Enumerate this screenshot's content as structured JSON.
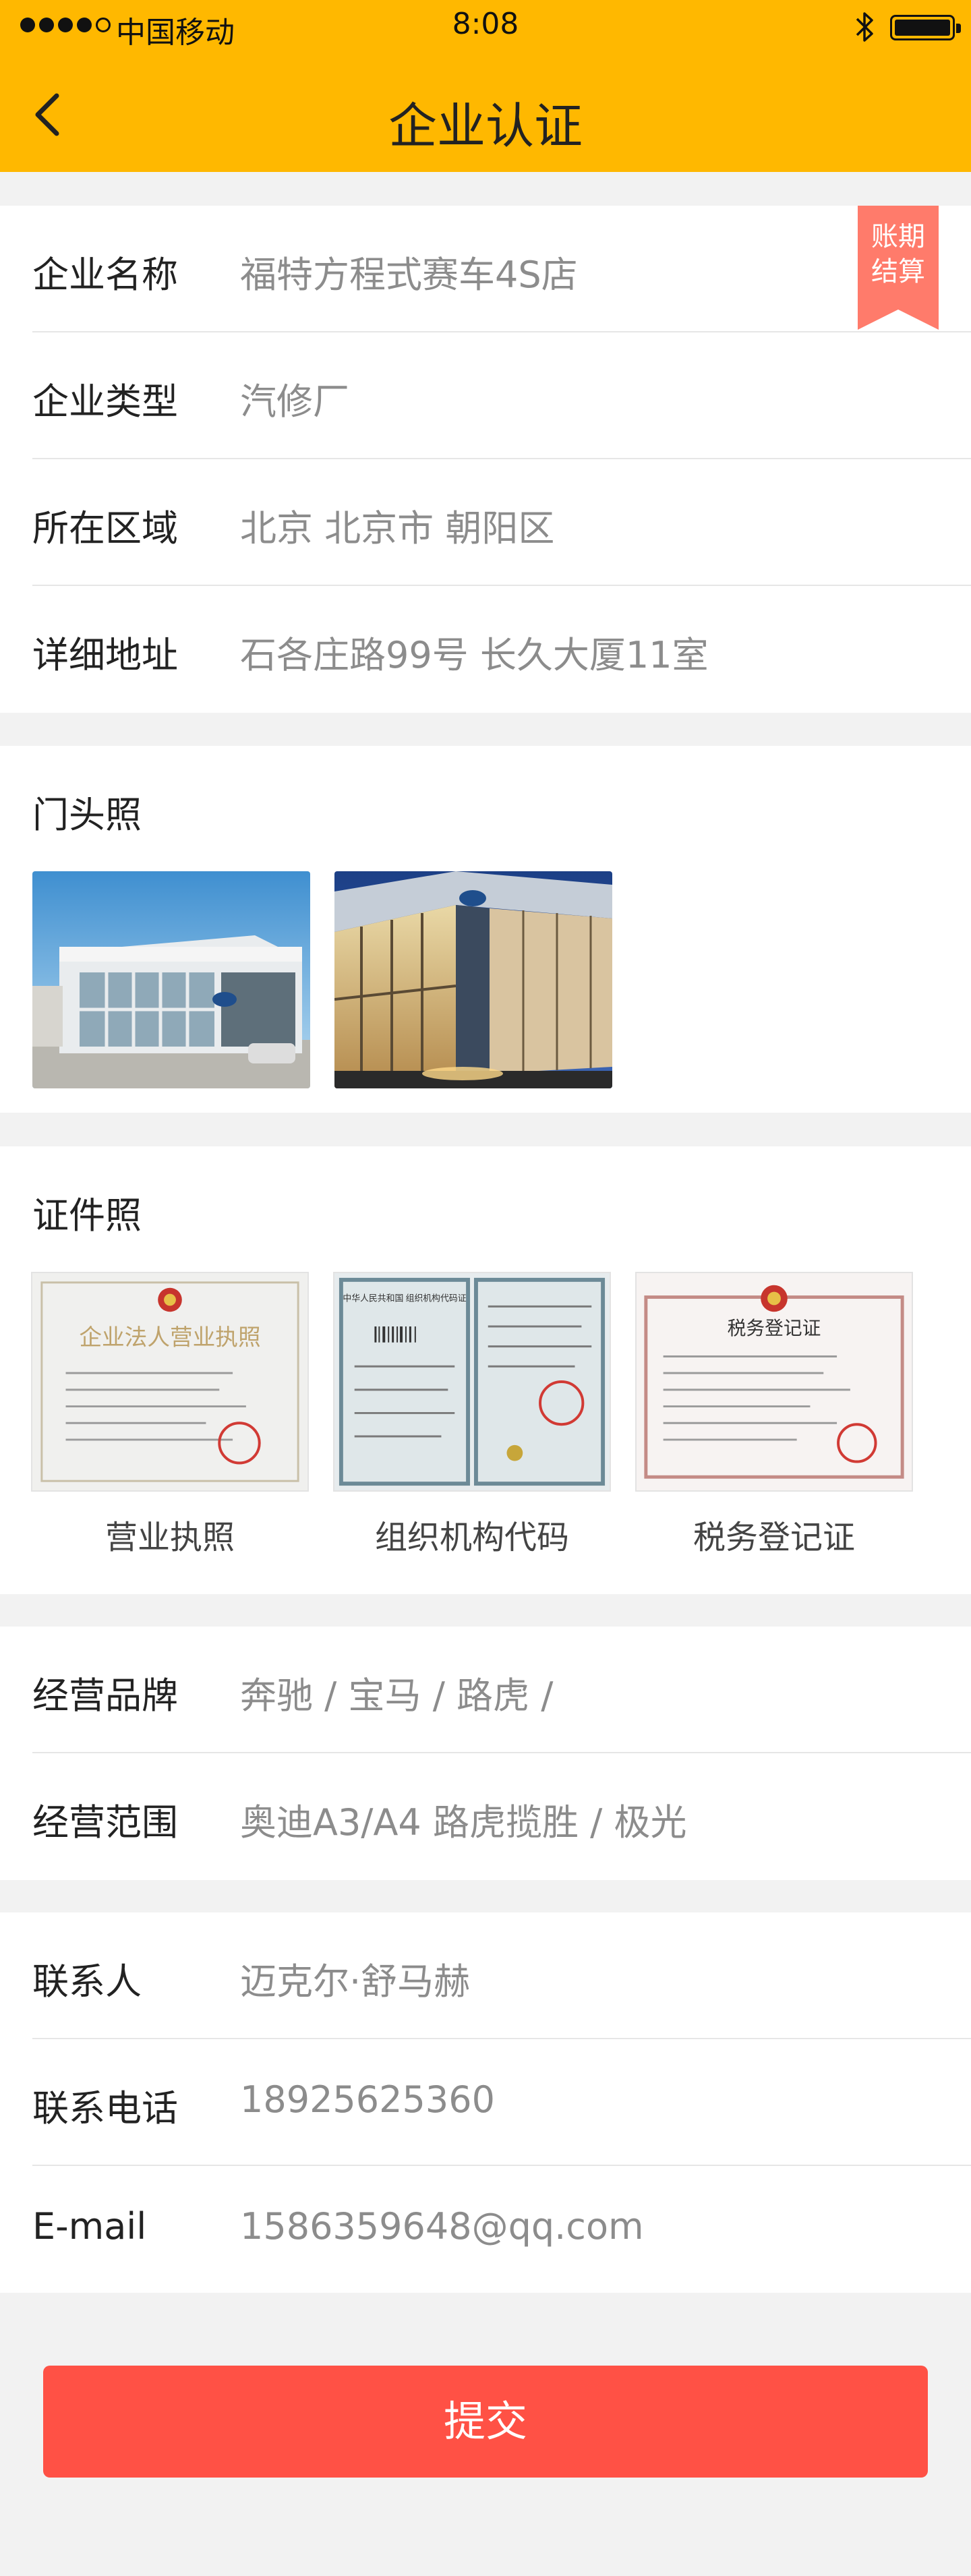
{
  "status": {
    "carrier": "中国移动",
    "time": "8:08"
  },
  "nav": {
    "title": "企业认证",
    "back_icon": "chevron-left-icon"
  },
  "colors": {
    "header": "#ffb800",
    "accent_badge": "#ff7b6b",
    "submit": "#ff5145"
  },
  "company": {
    "badge": "账期\n结算",
    "rows": [
      {
        "label": "企业名称",
        "value": "福特方程式赛车4S店"
      },
      {
        "label": "企业类型",
        "value": "汽修厂"
      },
      {
        "label": "所在区域",
        "value": "北京 北京市 朝阳区"
      },
      {
        "label": "详细地址",
        "value": "石各庄路99号 长久大厦11室"
      }
    ]
  },
  "storefront": {
    "title": "门头照"
  },
  "certificates": {
    "title": "证件照",
    "items": [
      {
        "caption": "营业执照",
        "heading": "企业法人营业执照"
      },
      {
        "caption": "组织机构代码",
        "heading": "中华人民共和国 组织机构代码证"
      },
      {
        "caption": "税务登记证",
        "heading": "税务登记证"
      }
    ]
  },
  "business": {
    "rows": [
      {
        "label": "经营品牌",
        "value": "奔驰 / 宝马 / 路虎 /"
      },
      {
        "label": "经营范围",
        "value": "奥迪A3/A4 路虎揽胜 / 极光"
      }
    ]
  },
  "contact": {
    "rows": [
      {
        "label": "联系人",
        "value": "迈克尔·舒马赫"
      },
      {
        "label": "联系电话",
        "value": "18925625360"
      },
      {
        "label": "E-mail",
        "value": "1586359648@qq.com"
      }
    ]
  },
  "submit_label": "提交"
}
